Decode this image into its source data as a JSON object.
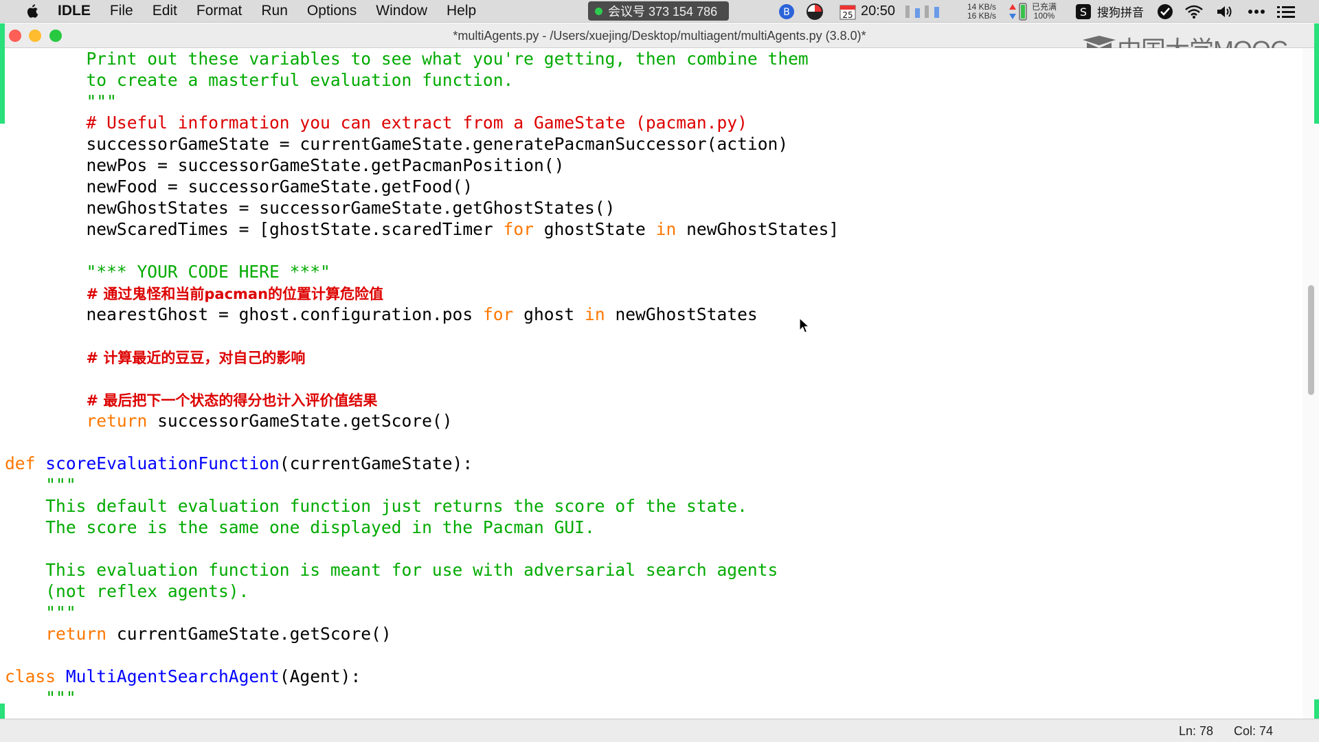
{
  "menubar": {
    "app": "IDLE",
    "menus": [
      "File",
      "Edit",
      "Format",
      "Run",
      "Options",
      "Window",
      "Help"
    ],
    "meeting": "会议号 373 154 786",
    "calendar_day": "25",
    "clock": "20:50",
    "net_up": "14 KB/s",
    "net_down": "16 KB/s",
    "battery": "已充满",
    "battery_pct": "100%",
    "input_method": "搜狗拼音"
  },
  "window": {
    "title": "*multiAgents.py - /Users/xuejing/Desktop/multiagent/multiAgents.py (3.8.0)*"
  },
  "watermark": "中国大学MOOC",
  "code": {
    "l1": "Print out these variables to see what you're getting, then combine them",
    "l2": "to create a masterful evaluation function.",
    "l3": "\"\"\"",
    "l4": "# Useful information you can extract from a GameState (pacman.py)",
    "l5": "successorGameState = currentGameState.generatePacmanSuccessor(action)",
    "l6": "newPos = successorGameState.getPacmanPosition()",
    "l7": "newFood = successorGameState.getFood()",
    "l8": "newGhostStates = successorGameState.getGhostStates()",
    "l9a": "newScaredTimes = [ghostState.scaredTimer ",
    "l9b": "for",
    "l9c": " ghostState ",
    "l9d": "in",
    "l9e": " newGhostStates]",
    "l11": "\"*** YOUR CODE HERE ***\"",
    "l12": "# 通过鬼怪和当前pacman的位置计算危险值",
    "l13a": "nearestGhost = ghost.configuration.pos ",
    "l13b": "for",
    "l13c": " ghost ",
    "l13d": "in",
    "l13e": " newGhostStates",
    "l15": "# 计算最近的豆豆，对自己的影响",
    "l17": "# 最后把下一个状态的得分也计入评价值结果",
    "l18a": "return",
    "l18b": " successorGameState.getScore()",
    "l20a": "def",
    "l20b": "scoreEvaluationFunction",
    "l20c": "(currentGameState):",
    "l21": "\"\"\"",
    "l22": "This default evaluation function just returns the score of the state.",
    "l23": "The score is the same one displayed in the Pacman GUI.",
    "l25": "This evaluation function is meant for use with adversarial search agents",
    "l26": "(not reflex agents).",
    "l27": "\"\"\"",
    "l28a": "return",
    "l28b": " currentGameState.getScore()",
    "l30a": "class",
    "l30b": "MultiAgentSearchAgent",
    "l30c": "(Agent):",
    "l31": "\"\"\""
  },
  "status": {
    "ln": "Ln: 78",
    "col": "Col: 74"
  },
  "colors": {
    "keyword": "#ff7700",
    "definition": "#0000ff",
    "comment": "#dd0000",
    "string": "#00aa00"
  }
}
